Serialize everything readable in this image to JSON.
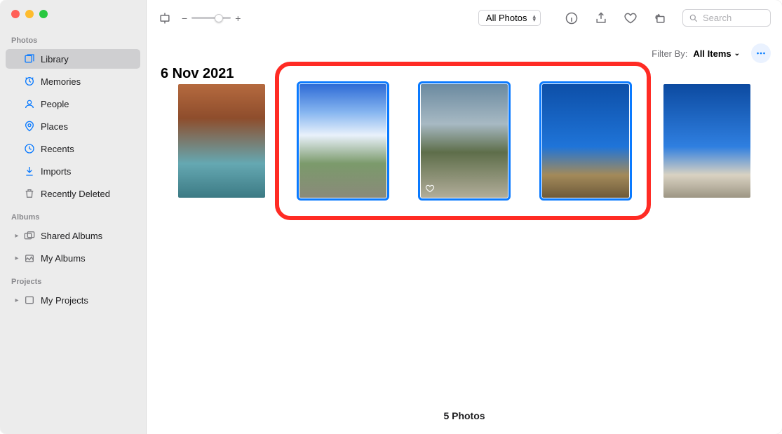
{
  "sidebar": {
    "sections": {
      "photos_label": "Photos",
      "albums_label": "Albums",
      "projects_label": "Projects"
    },
    "items": {
      "library": "Library",
      "memories": "Memories",
      "people": "People",
      "places": "Places",
      "recents": "Recents",
      "imports": "Imports",
      "recently_deleted": "Recently Deleted",
      "shared_albums": "Shared Albums",
      "my_albums": "My Albums",
      "my_projects": "My Projects"
    }
  },
  "toolbar": {
    "view_select": "All Photos",
    "search_placeholder": "Search"
  },
  "filter": {
    "label": "Filter By:",
    "value": "All Items"
  },
  "content": {
    "date_heading": "6 Nov 2021",
    "footer": "5 Photos"
  }
}
